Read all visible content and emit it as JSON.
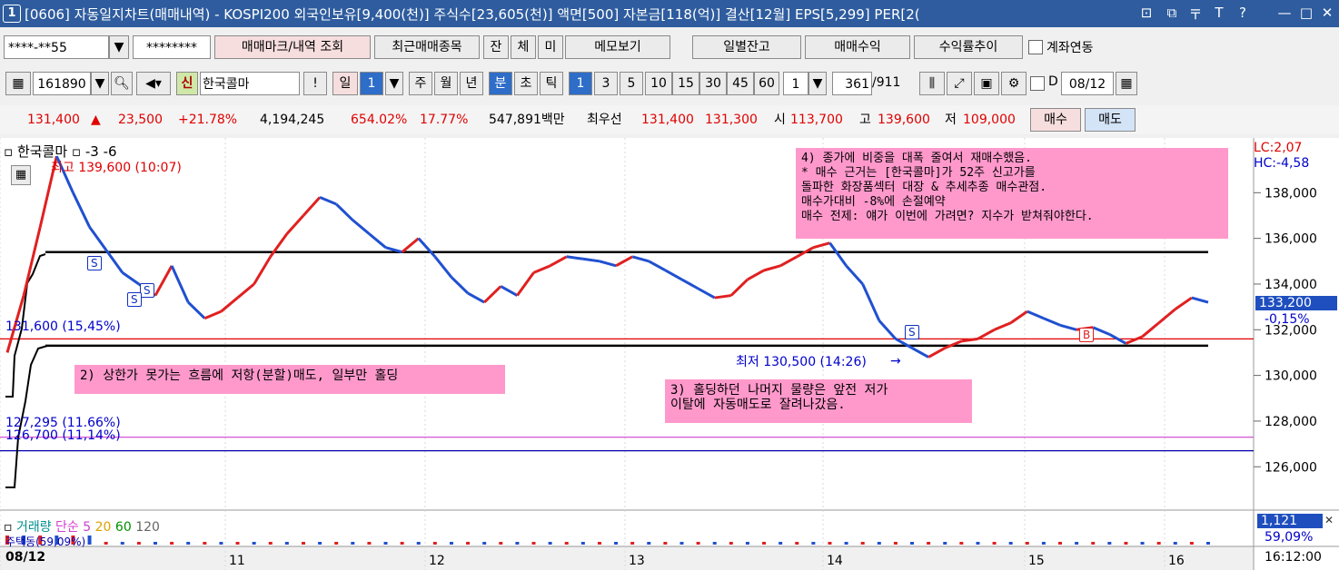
{
  "window": {
    "number": "1",
    "title": "[0606] 자동일지차트(매매내역) - KOSPI200 외국인보유[9,400(천)] 주식수[23,605(천)] 액면[500] 자본금[118(억)] 결산[12월] EPS[5,299] PER[2(",
    "buttons": [
      "⊡",
      "⧉",
      "〒",
      "T",
      "?",
      "—",
      "□",
      "✕"
    ]
  },
  "toolbar1": {
    "account": "****-**55",
    "password": "********",
    "buttons": [
      "매매마크/내역 조회",
      "최근매매종목",
      "잔",
      "체",
      "미",
      "메모보기",
      "일별잔고",
      "매매수익",
      "수익률추이"
    ],
    "link_label": "계좌연동"
  },
  "toolbar2": {
    "code": "161890",
    "stock_name": "한국콜마",
    "credit_badge": "신",
    "bang": "!",
    "period_label": "일",
    "period_value": "1",
    "periods": [
      "주",
      "월",
      "년",
      "분",
      "초",
      "틱"
    ],
    "intervals": [
      "1",
      "3",
      "5",
      "10",
      "15",
      "30",
      "45",
      "60"
    ],
    "count_value": "1",
    "count_now": "361",
    "count_total": "/911",
    "date_label": "D",
    "date_value": "08/12"
  },
  "quote": {
    "price": "131,400",
    "arrow": "▲",
    "change": "23,500",
    "rate": "+21.78%",
    "volume": "4,194,245",
    "vol_ratio": "654.02%",
    "turnover": "17.77%",
    "amount": "547,891백만",
    "best_label": "최우선",
    "ask": "131,400",
    "bid": "131,300",
    "open_label": "시",
    "open": "113,700",
    "high_label": "고",
    "high": "139,600",
    "low_label": "저",
    "low": "109,000",
    "buy_button": "매수",
    "sell_button": "매도"
  },
  "chart": {
    "legend_name": "한국콜마",
    "legend_extra": "-3  -6",
    "high_marker": "최고 139,600 (10:07)",
    "low_marker": "최저 130,500 (14:26)",
    "level_labels": [
      "131,600 (15,45%)",
      "127,295 (11.66%)",
      "126,700 (11,14%)"
    ],
    "lc_label": "LC:2,07",
    "hc_label": "HC:-4,58",
    "current_price": "133,200",
    "current_rate": "-0,15%",
    "annotations": [
      "2) 상한가 못가는 흐름에 저항(분할)매도, 일부만 홀딩",
      "3) 홀딩하던 나머지 물량은 앞전 저가\n이탈에 자동매도로 잘려나갔음.",
      "4) 종가에 비중을 대폭 줄여서 재매수했음.\n* 매수 근거는 [한국콜마]가 52주 신고가를\n돌파한 화장품섹터 대장 & 추세추종 매수관점.\n매수가대비 -8%에 손절예약\n매수 전제: 얘가 이번에 가려면? 지수가 받쳐줘야한다."
    ],
    "markers": [
      "S",
      "S",
      "S",
      "S",
      "B"
    ],
    "volume_legend": [
      "거래량",
      "단순",
      "5",
      "20",
      "60",
      "120"
    ],
    "volume_value": "1,121",
    "volume_rate": "59,09%",
    "volume_left_label": "주택동(59,09%)",
    "time_label": "16:12:00",
    "date_start": "08/12"
  },
  "chart_data": {
    "type": "line",
    "title": "",
    "xlabel": "",
    "ylabel": "",
    "y_ticks": [
      126000,
      128000,
      130000,
      132000,
      134000,
      136000,
      138000
    ],
    "ylim": [
      124500,
      140000
    ],
    "x_ticks": [
      "08/12",
      "11",
      "12",
      "13",
      "14",
      "15",
      "16"
    ],
    "series": [
      {
        "values": [
          131000,
          133500,
          136500,
          139600,
          138000,
          136500,
          135500,
          134500,
          134000,
          133500,
          134800,
          133200,
          132500,
          132800,
          133400,
          134000,
          135200,
          136200,
          137000,
          137800,
          137500,
          136800,
          136200,
          135600,
          135400,
          136000,
          135200,
          134300,
          133600,
          133200,
          133900,
          133500,
          134500,
          134800,
          135200,
          135100,
          135000,
          134800,
          135200,
          135000,
          134600,
          134200,
          133800,
          133400,
          133500,
          134200,
          134600,
          134800,
          135200,
          135600,
          135800,
          134800,
          134000,
          132400,
          131600,
          131200,
          130800,
          131200,
          131500,
          131600,
          132000,
          132300,
          132800,
          132500,
          132200,
          132000,
          132100,
          131800,
          131400,
          131700,
          132300,
          132900,
          133400,
          133200
        ],
        "color": "#e02020"
      }
    ],
    "levels": [
      {
        "value": 135400,
        "color": "#000000"
      },
      {
        "value": 131300,
        "color": "#000000"
      },
      {
        "value": 131600,
        "color": "#e00000"
      },
      {
        "value": 127295,
        "color": "#d040d0"
      },
      {
        "value": 126700,
        "color": "#0000aa"
      }
    ],
    "grid": true
  }
}
